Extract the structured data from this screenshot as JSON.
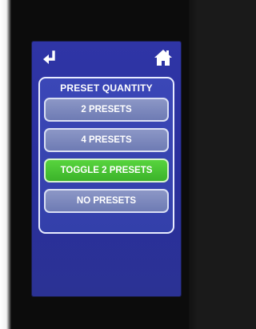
{
  "header": {
    "back_icon": "return-arrow-icon",
    "home_icon": "home-icon"
  },
  "panel": {
    "title": "PRESET QUANTITY",
    "options": [
      {
        "label": "2 PRESETS",
        "selected": false
      },
      {
        "label": "4 PRESETS",
        "selected": false
      },
      {
        "label": "TOGGLE 2 PRESETS",
        "selected": true
      },
      {
        "label": "NO PRESETS",
        "selected": false
      }
    ]
  },
  "colors": {
    "screen_bg": "#2f35a6",
    "button_bg": "#7f8abf",
    "selected_bg": "#4ccb37",
    "text": "#ffffff"
  }
}
